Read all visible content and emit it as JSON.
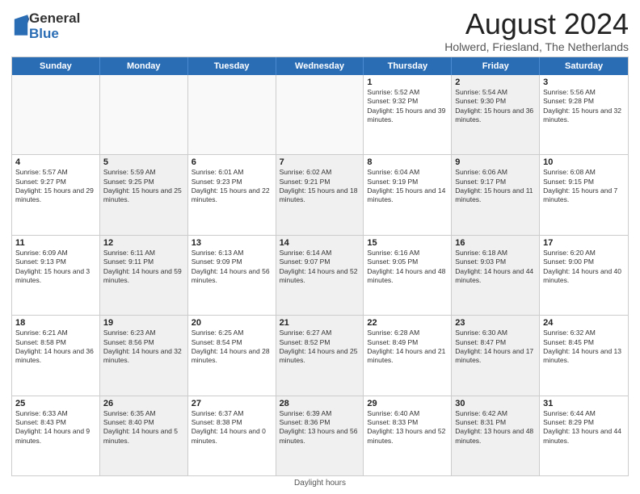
{
  "logo": {
    "general": "General",
    "blue": "Blue"
  },
  "title": "August 2024",
  "subtitle": "Holwerd, Friesland, The Netherlands",
  "header_days": [
    "Sunday",
    "Monday",
    "Tuesday",
    "Wednesday",
    "Thursday",
    "Friday",
    "Saturday"
  ],
  "rows": [
    [
      {
        "day": "",
        "info": "",
        "shaded": false,
        "empty": true
      },
      {
        "day": "",
        "info": "",
        "shaded": false,
        "empty": true
      },
      {
        "day": "",
        "info": "",
        "shaded": false,
        "empty": true
      },
      {
        "day": "",
        "info": "",
        "shaded": false,
        "empty": true
      },
      {
        "day": "1",
        "info": "Sunrise: 5:52 AM\nSunset: 9:32 PM\nDaylight: 15 hours and 39 minutes.",
        "shaded": false,
        "empty": false
      },
      {
        "day": "2",
        "info": "Sunrise: 5:54 AM\nSunset: 9:30 PM\nDaylight: 15 hours and 36 minutes.",
        "shaded": true,
        "empty": false
      },
      {
        "day": "3",
        "info": "Sunrise: 5:56 AM\nSunset: 9:28 PM\nDaylight: 15 hours and 32 minutes.",
        "shaded": false,
        "empty": false
      }
    ],
    [
      {
        "day": "4",
        "info": "Sunrise: 5:57 AM\nSunset: 9:27 PM\nDaylight: 15 hours and 29 minutes.",
        "shaded": false,
        "empty": false
      },
      {
        "day": "5",
        "info": "Sunrise: 5:59 AM\nSunset: 9:25 PM\nDaylight: 15 hours and 25 minutes.",
        "shaded": true,
        "empty": false
      },
      {
        "day": "6",
        "info": "Sunrise: 6:01 AM\nSunset: 9:23 PM\nDaylight: 15 hours and 22 minutes.",
        "shaded": false,
        "empty": false
      },
      {
        "day": "7",
        "info": "Sunrise: 6:02 AM\nSunset: 9:21 PM\nDaylight: 15 hours and 18 minutes.",
        "shaded": true,
        "empty": false
      },
      {
        "day": "8",
        "info": "Sunrise: 6:04 AM\nSunset: 9:19 PM\nDaylight: 15 hours and 14 minutes.",
        "shaded": false,
        "empty": false
      },
      {
        "day": "9",
        "info": "Sunrise: 6:06 AM\nSunset: 9:17 PM\nDaylight: 15 hours and 11 minutes.",
        "shaded": true,
        "empty": false
      },
      {
        "day": "10",
        "info": "Sunrise: 6:08 AM\nSunset: 9:15 PM\nDaylight: 15 hours and 7 minutes.",
        "shaded": false,
        "empty": false
      }
    ],
    [
      {
        "day": "11",
        "info": "Sunrise: 6:09 AM\nSunset: 9:13 PM\nDaylight: 15 hours and 3 minutes.",
        "shaded": false,
        "empty": false
      },
      {
        "day": "12",
        "info": "Sunrise: 6:11 AM\nSunset: 9:11 PM\nDaylight: 14 hours and 59 minutes.",
        "shaded": true,
        "empty": false
      },
      {
        "day": "13",
        "info": "Sunrise: 6:13 AM\nSunset: 9:09 PM\nDaylight: 14 hours and 56 minutes.",
        "shaded": false,
        "empty": false
      },
      {
        "day": "14",
        "info": "Sunrise: 6:14 AM\nSunset: 9:07 PM\nDaylight: 14 hours and 52 minutes.",
        "shaded": true,
        "empty": false
      },
      {
        "day": "15",
        "info": "Sunrise: 6:16 AM\nSunset: 9:05 PM\nDaylight: 14 hours and 48 minutes.",
        "shaded": false,
        "empty": false
      },
      {
        "day": "16",
        "info": "Sunrise: 6:18 AM\nSunset: 9:03 PM\nDaylight: 14 hours and 44 minutes.",
        "shaded": true,
        "empty": false
      },
      {
        "day": "17",
        "info": "Sunrise: 6:20 AM\nSunset: 9:00 PM\nDaylight: 14 hours and 40 minutes.",
        "shaded": false,
        "empty": false
      }
    ],
    [
      {
        "day": "18",
        "info": "Sunrise: 6:21 AM\nSunset: 8:58 PM\nDaylight: 14 hours and 36 minutes.",
        "shaded": false,
        "empty": false
      },
      {
        "day": "19",
        "info": "Sunrise: 6:23 AM\nSunset: 8:56 PM\nDaylight: 14 hours and 32 minutes.",
        "shaded": true,
        "empty": false
      },
      {
        "day": "20",
        "info": "Sunrise: 6:25 AM\nSunset: 8:54 PM\nDaylight: 14 hours and 28 minutes.",
        "shaded": false,
        "empty": false
      },
      {
        "day": "21",
        "info": "Sunrise: 6:27 AM\nSunset: 8:52 PM\nDaylight: 14 hours and 25 minutes.",
        "shaded": true,
        "empty": false
      },
      {
        "day": "22",
        "info": "Sunrise: 6:28 AM\nSunset: 8:49 PM\nDaylight: 14 hours and 21 minutes.",
        "shaded": false,
        "empty": false
      },
      {
        "day": "23",
        "info": "Sunrise: 6:30 AM\nSunset: 8:47 PM\nDaylight: 14 hours and 17 minutes.",
        "shaded": true,
        "empty": false
      },
      {
        "day": "24",
        "info": "Sunrise: 6:32 AM\nSunset: 8:45 PM\nDaylight: 14 hours and 13 minutes.",
        "shaded": false,
        "empty": false
      }
    ],
    [
      {
        "day": "25",
        "info": "Sunrise: 6:33 AM\nSunset: 8:43 PM\nDaylight: 14 hours and 9 minutes.",
        "shaded": false,
        "empty": false
      },
      {
        "day": "26",
        "info": "Sunrise: 6:35 AM\nSunset: 8:40 PM\nDaylight: 14 hours and 5 minutes.",
        "shaded": true,
        "empty": false
      },
      {
        "day": "27",
        "info": "Sunrise: 6:37 AM\nSunset: 8:38 PM\nDaylight: 14 hours and 0 minutes.",
        "shaded": false,
        "empty": false
      },
      {
        "day": "28",
        "info": "Sunrise: 6:39 AM\nSunset: 8:36 PM\nDaylight: 13 hours and 56 minutes.",
        "shaded": true,
        "empty": false
      },
      {
        "day": "29",
        "info": "Sunrise: 6:40 AM\nSunset: 8:33 PM\nDaylight: 13 hours and 52 minutes.",
        "shaded": false,
        "empty": false
      },
      {
        "day": "30",
        "info": "Sunrise: 6:42 AM\nSunset: 8:31 PM\nDaylight: 13 hours and 48 minutes.",
        "shaded": true,
        "empty": false
      },
      {
        "day": "31",
        "info": "Sunrise: 6:44 AM\nSunset: 8:29 PM\nDaylight: 13 hours and 44 minutes.",
        "shaded": false,
        "empty": false
      }
    ]
  ],
  "footer": "Daylight hours"
}
